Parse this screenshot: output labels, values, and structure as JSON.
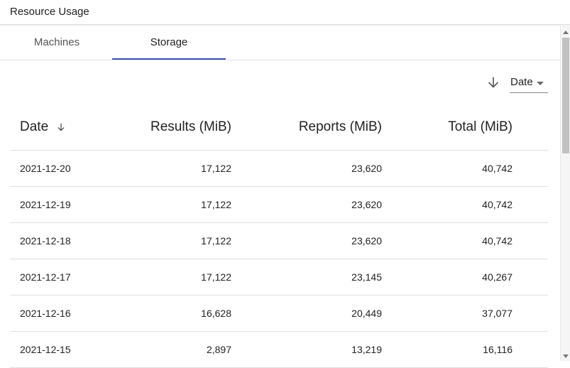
{
  "header": {
    "title": "Resource Usage"
  },
  "tabs": [
    {
      "label": "Machines",
      "active": false
    },
    {
      "label": "Storage",
      "active": true
    }
  ],
  "sort": {
    "selected": "Date",
    "direction_icon": "arrow-down-icon"
  },
  "table": {
    "columns": [
      "Date",
      "Results (MiB)",
      "Reports (MiB)",
      "Total (MiB)"
    ],
    "rows": [
      {
        "date": "2021-12-20",
        "results": "17,122",
        "reports": "23,620",
        "total": "40,742"
      },
      {
        "date": "2021-12-19",
        "results": "17,122",
        "reports": "23,620",
        "total": "40,742"
      },
      {
        "date": "2021-12-18",
        "results": "17,122",
        "reports": "23,620",
        "total": "40,742"
      },
      {
        "date": "2021-12-17",
        "results": "17,122",
        "reports": "23,145",
        "total": "40,267"
      },
      {
        "date": "2021-12-16",
        "results": "16,628",
        "reports": "20,449",
        "total": "37,077"
      },
      {
        "date": "2021-12-15",
        "results": "2,897",
        "reports": "13,219",
        "total": "16,116"
      }
    ]
  },
  "colors": {
    "accent": "#3f51b5",
    "divider": "#e0e0e0"
  }
}
